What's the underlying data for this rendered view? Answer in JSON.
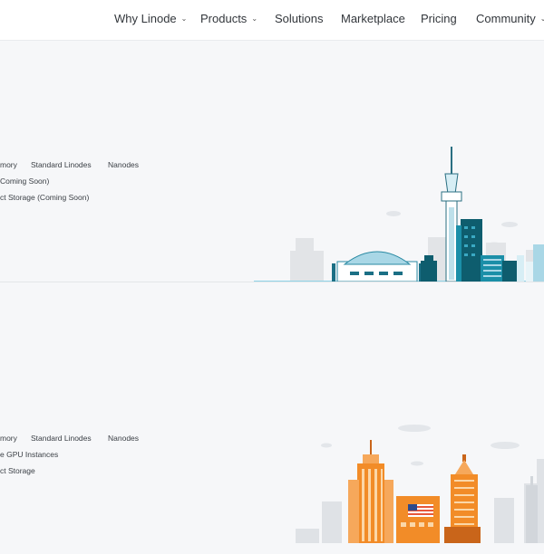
{
  "nav": {
    "items": [
      {
        "label": "Why Linode",
        "dropdown": true
      },
      {
        "label": "Products",
        "dropdown": true
      },
      {
        "label": "Solutions",
        "dropdown": false
      },
      {
        "label": "Marketplace",
        "dropdown": false
      },
      {
        "label": "Pricing",
        "dropdown": false
      },
      {
        "label": "Community",
        "dropdown": true
      }
    ],
    "caret_glyph": "⌄"
  },
  "regions": [
    {
      "links_row1": [
        "mory",
        "Standard Linodes",
        "Nanodes"
      ],
      "links_row2": [
        "Coming Soon)"
      ],
      "links_row3": [
        "ct Storage (Coming Soon)"
      ],
      "colors": {
        "primary": "#1b8fa8",
        "dark": "#0e5d6e",
        "light": "#a9d7e6"
      }
    },
    {
      "links_row1": [
        "mory",
        "Standard Linodes",
        "Nanodes"
      ],
      "links_row2": [
        "e GPU Instances"
      ],
      "links_row3": [
        "ct Storage"
      ],
      "colors": {
        "primary": "#f28c28",
        "dark": "#c9651a",
        "light": "#fbc98a"
      }
    }
  ]
}
